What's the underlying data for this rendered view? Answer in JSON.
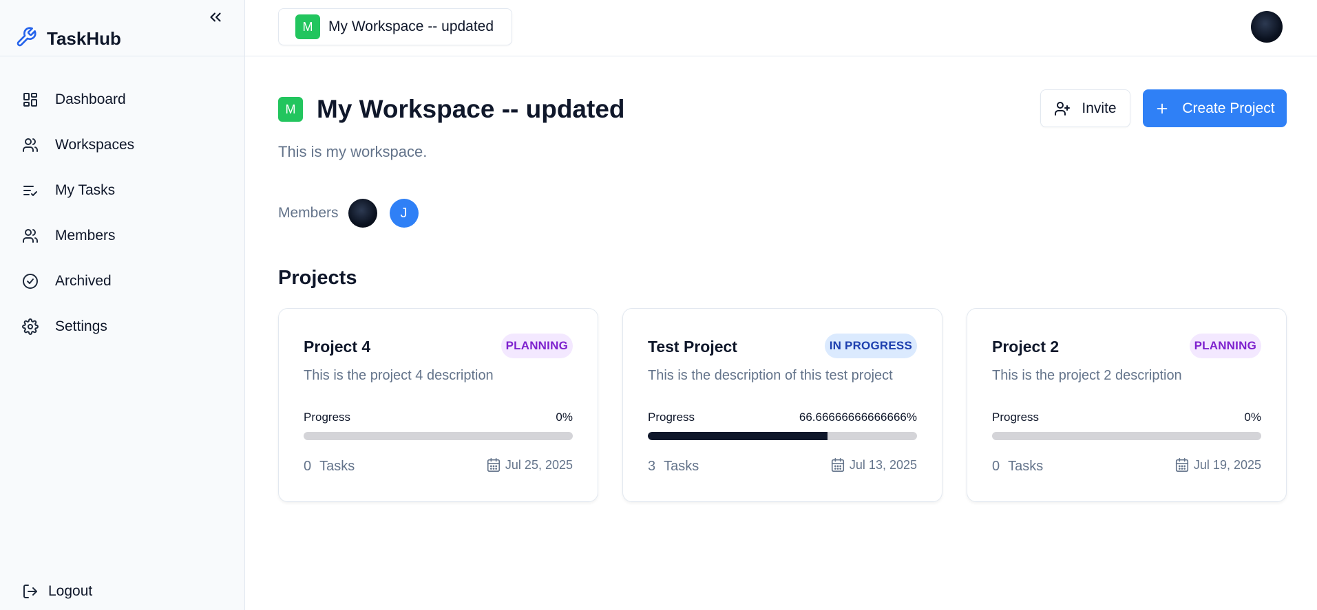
{
  "app": {
    "name": "TaskHub"
  },
  "sidebar": {
    "items": [
      {
        "label": "Dashboard",
        "icon": "dashboard-icon"
      },
      {
        "label": "Workspaces",
        "icon": "users-icon"
      },
      {
        "label": "My Tasks",
        "icon": "list-check-icon"
      },
      {
        "label": "Members",
        "icon": "users-icon"
      },
      {
        "label": "Archived",
        "icon": "check-circle-icon"
      },
      {
        "label": "Settings",
        "icon": "gear-icon"
      }
    ],
    "logout_label": "Logout"
  },
  "topbar": {
    "workspace_initial": "M",
    "workspace_name": "My Workspace -- updated"
  },
  "workspace": {
    "initial": "M",
    "title": "My Workspace -- updated",
    "description": "This is my workspace.",
    "invite_label": "Invite",
    "create_project_label": "Create Project",
    "members_label": "Members",
    "members": [
      {
        "type": "photo"
      },
      {
        "type": "letter",
        "initial": "J"
      }
    ],
    "accent_color": "#22c55e"
  },
  "projects": {
    "section_title": "Projects",
    "progress_label": "Progress",
    "tasks_label": "Tasks",
    "items": [
      {
        "title": "Project 4",
        "status": "PLANNING",
        "description": "This is the project 4 description",
        "progress_text": "0%",
        "progress": 0,
        "tasks": "0",
        "due": "Jul 25, 2025"
      },
      {
        "title": "Test Project",
        "status": "IN PROGRESS",
        "description": "This is the description of this test project",
        "progress_text": "66.66666666666666%",
        "progress": 66.67,
        "tasks": "3",
        "due": "Jul 13, 2025"
      },
      {
        "title": "Project 2",
        "status": "PLANNING",
        "description": "This is the project 2 description",
        "progress_text": "0%",
        "progress": 0,
        "tasks": "0",
        "due": "Jul 19, 2025"
      }
    ]
  },
  "colors": {
    "primary": "#2f80f6",
    "planning_bg": "#f3e8ff",
    "planning_fg": "#7e22ce",
    "in_progress_bg": "#dbeafe",
    "in_progress_fg": "#1e40af"
  }
}
